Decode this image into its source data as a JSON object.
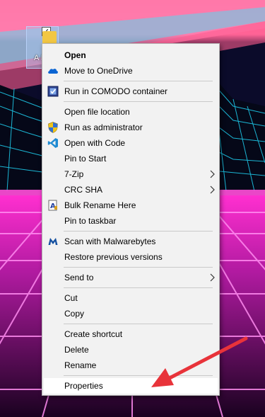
{
  "desktop_icon": {
    "label": "A N",
    "checked": "✓"
  },
  "menu": {
    "open": "Open",
    "move_onedrive": "Move to OneDrive",
    "run_comodo": "Run in COMODO container",
    "open_file_location": "Open file location",
    "run_as_admin": "Run as administrator",
    "open_with_code": "Open with Code",
    "pin_to_start": "Pin to Start",
    "seven_zip": "7-Zip",
    "crc_sha": "CRC SHA",
    "bulk_rename": "Bulk Rename Here",
    "pin_taskbar": "Pin to taskbar",
    "malwarebytes": "Scan with Malwarebytes",
    "restore_versions": "Restore previous versions",
    "send_to": "Send to",
    "cut": "Cut",
    "copy": "Copy",
    "create_shortcut": "Create shortcut",
    "delete": "Delete",
    "rename": "Rename",
    "properties": "Properties"
  },
  "icons": {
    "onedrive": "cloud-icon",
    "comodo": "comodo-container-icon",
    "run_as_admin": "uac-shield-icon",
    "open_with_code": "vscode-icon",
    "bulk_rename": "bulk-rename-icon",
    "malwarebytes": "malwarebytes-icon",
    "submenu": "chevron-right-icon"
  },
  "colors": {
    "menu_bg": "#f2f2f2",
    "annotation_arrow": "#e8333a",
    "onedrive_blue": "#0a64d2",
    "vscode_blue": "#1f8ad2",
    "malwarebytes_blue": "#1450a0"
  }
}
